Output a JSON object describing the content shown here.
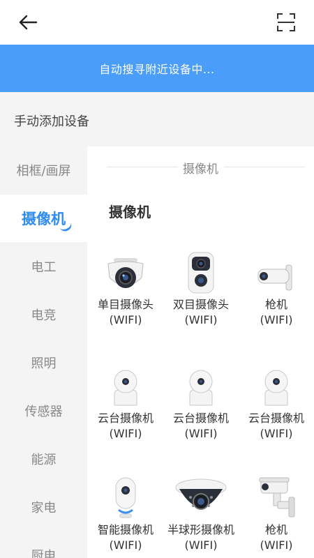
{
  "banner": {
    "text": "自动搜寻附近设备中..."
  },
  "manual": {
    "label": "手动添加设备"
  },
  "sidebar": {
    "items": [
      {
        "label": "相框/画屏"
      },
      {
        "label": "摄像机"
      },
      {
        "label": "电工"
      },
      {
        "label": "电竞"
      },
      {
        "label": "照明"
      },
      {
        "label": "传感器"
      },
      {
        "label": "能源"
      },
      {
        "label": "家电"
      },
      {
        "label": "厨电"
      }
    ],
    "active_index": 1
  },
  "content": {
    "divider_title": "摄像机",
    "section_title": "摄像机",
    "devices": [
      {
        "name": "单目摄像头",
        "sub": "(WIFI)",
        "icon": "dome-camera-icon"
      },
      {
        "name": "双目摄像头",
        "sub": "(WIFI)",
        "icon": "dual-lens-camera-icon"
      },
      {
        "name": "枪机",
        "sub": "(WIFI)",
        "icon": "bullet-camera-icon"
      },
      {
        "name": "云台摄像机",
        "sub": "(WIFI)",
        "icon": "ptz-camera-icon"
      },
      {
        "name": "云台摄像机",
        "sub": "(WIFI)",
        "icon": "ptz-camera-icon"
      },
      {
        "name": "云台摄像机",
        "sub": "(WIFI)",
        "icon": "ptz-camera-icon"
      },
      {
        "name": "智能摄像机",
        "sub": "(WIFI)",
        "icon": "smart-camera-icon"
      },
      {
        "name": "半球形摄像机",
        "sub": "(WIFI)",
        "icon": "hemisphere-camera-icon"
      },
      {
        "name": "枪机",
        "sub": "(WIFI)",
        "icon": "outdoor-bullet-camera-icon"
      }
    ]
  },
  "colors": {
    "accent": "#2f8cf2",
    "banner": "#4a9df8"
  }
}
